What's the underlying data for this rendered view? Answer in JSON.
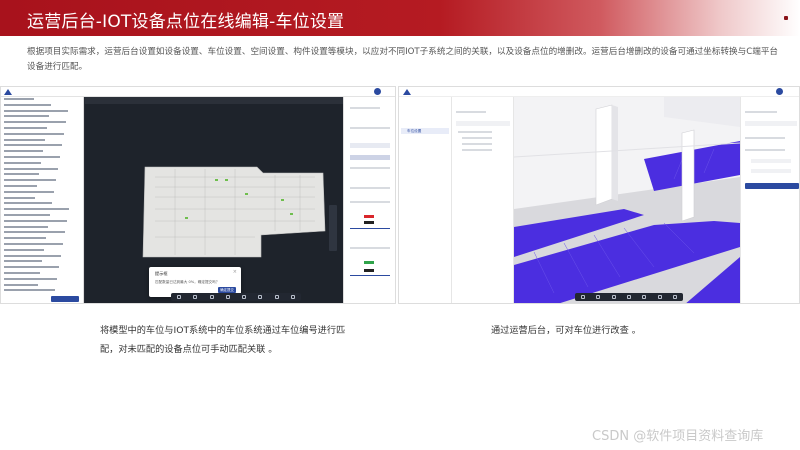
{
  "header": {
    "title": "运营后台-IOT设备点位在线编辑-车位设置"
  },
  "description": "根据项目实际需求，运营后台设置如设备设置、车位设置、空间设置、构件设置等模块，以应对不同IOT子系统之间的关联，以及设备点位的增删改。运营后台增删改的设备可通过坐标转换与C端平台设备进行匹配。",
  "left_screenshot": {
    "dialog": {
      "title": "提示框",
      "message": "匹配数量已达到最大 0%，确定提交吗？",
      "close": "×",
      "confirm_label": "确定提交"
    },
    "sidebar_item_count": 34
  },
  "right_screenshot": {
    "sidebar": {
      "sel_label": "车位设置"
    }
  },
  "captions": {
    "left": "将模型中的车位与IOT系统中的车位系统通过车位编号进行匹配，对未匹配的设备点位可手动匹配关联 。",
    "right": "通过运营后台，可对车位进行改查 。"
  },
  "watermark": "CSDN @软件项目资料查询库",
  "colors": {
    "banner": "#b51b22",
    "accent": "#2b4aa0",
    "parking": "#4b2ee0"
  }
}
